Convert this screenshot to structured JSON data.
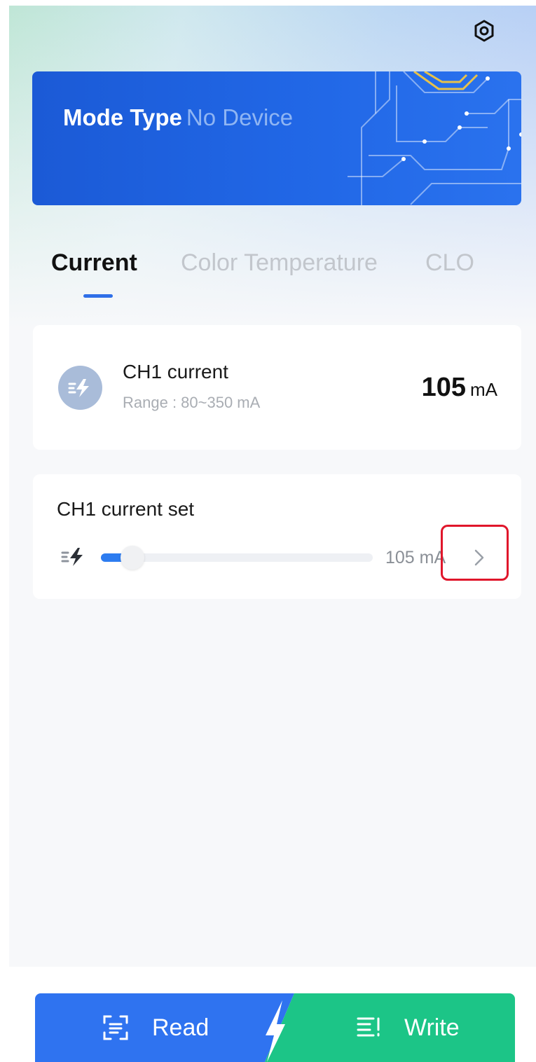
{
  "colors": {
    "banner": "#1b5ad6",
    "accent": "#2f6fe8",
    "read_button": "#2f73f0",
    "write_button": "#1cc587",
    "highlight": "#e0162b"
  },
  "header": {
    "settings_icon": "settings-hex-icon"
  },
  "banner": {
    "label": "Mode Type",
    "value": "No Device"
  },
  "tabs": [
    {
      "label": "Current",
      "active": true
    },
    {
      "label": "Color Temperature",
      "active": false
    },
    {
      "label": "CLO",
      "active": false
    }
  ],
  "current_card": {
    "icon": "lightning-icon",
    "title": "CH1 current",
    "range": "Range : 80~350 mA",
    "value": "105",
    "unit": "mA"
  },
  "set_card": {
    "title": "CH1 current set",
    "icon": "lightning-speed-icon",
    "slider_fraction": 0.09,
    "value_text": "105 mA",
    "chevron_icon": "chevron-right-icon"
  },
  "bottom": {
    "read_label": "Read",
    "read_icon": "scan-icon",
    "write_label": "Write",
    "write_icon": "write-list-icon"
  }
}
